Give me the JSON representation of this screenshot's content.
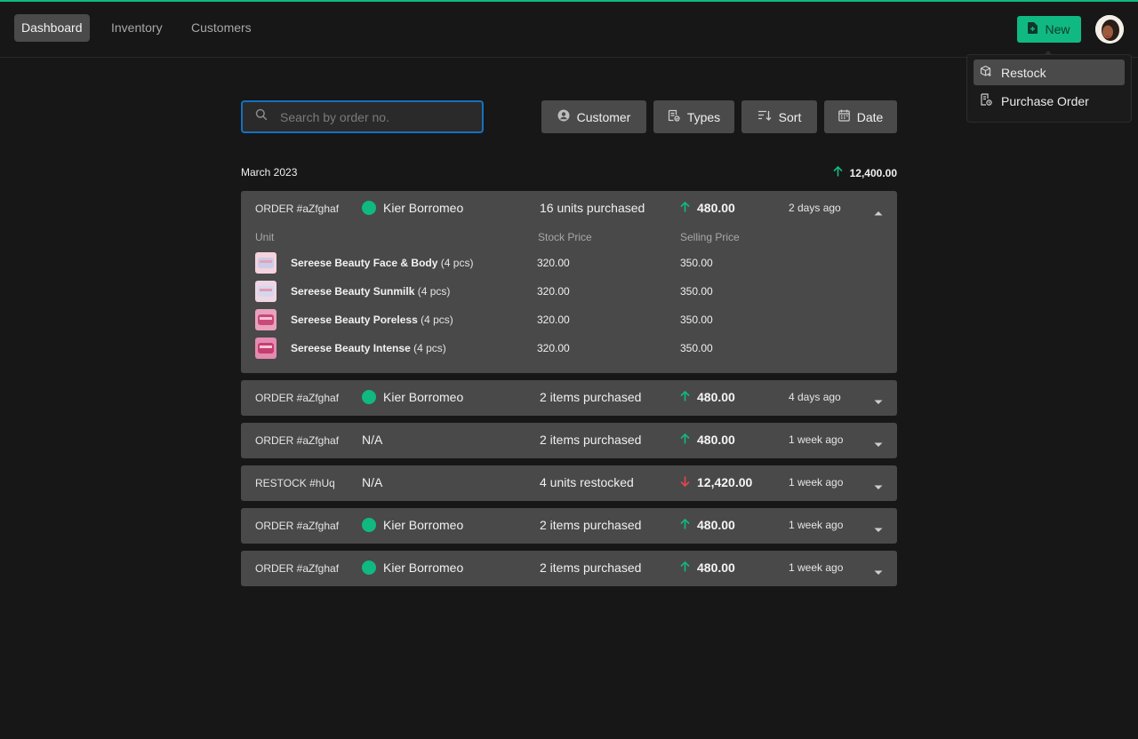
{
  "nav": {
    "items": [
      {
        "label": "Dashboard",
        "active": true
      },
      {
        "label": "Inventory",
        "active": false
      },
      {
        "label": "Customers",
        "active": false
      }
    ],
    "new_label": "New"
  },
  "dropdown": {
    "items": [
      {
        "label": "Restock",
        "icon": "box-plus-icon",
        "highlighted": true
      },
      {
        "label": "Purchase Order",
        "icon": "document-clock-icon",
        "highlighted": false
      }
    ]
  },
  "search": {
    "placeholder": "Search by order no.",
    "value": ""
  },
  "filters": [
    {
      "label": "Customer",
      "icon": "user-circle-icon"
    },
    {
      "label": "Types",
      "icon": "list-check-icon"
    },
    {
      "label": "Sort",
      "icon": "sort-icon"
    },
    {
      "label": "Date",
      "icon": "calendar-icon"
    }
  ],
  "group": {
    "month": "March 2023",
    "total": "12,400.00"
  },
  "expanded_headers": {
    "unit": "Unit",
    "stock": "Stock Price",
    "selling": "Selling Price"
  },
  "orders": [
    {
      "id": "ORDER #aZfghaf",
      "customer": "Kier Borromeo",
      "has_avatar": true,
      "summary": "16 units purchased",
      "amount": "480.00",
      "direction": "up",
      "time": "2 days ago",
      "expanded": true,
      "items": [
        {
          "name": "Sereese Beauty Face & Body",
          "qty": "(4 pcs)",
          "stock": "320.00",
          "sell": "350.00"
        },
        {
          "name": "Sereese Beauty Sunmilk",
          "qty": "(4 pcs)",
          "stock": "320.00",
          "sell": "350.00"
        },
        {
          "name": "Sereese Beauty Poreless",
          "qty": "(4 pcs)",
          "stock": "320.00",
          "sell": "350.00"
        },
        {
          "name": "Sereese Beauty Intense",
          "qty": "(4 pcs)",
          "stock": "320.00",
          "sell": "350.00"
        }
      ]
    },
    {
      "id": "ORDER #aZfghaf",
      "customer": "Kier Borromeo",
      "has_avatar": true,
      "summary": "2 items purchased",
      "amount": "480.00",
      "direction": "up",
      "time": "4 days ago",
      "expanded": false
    },
    {
      "id": "ORDER #aZfghaf",
      "customer": "N/A",
      "has_avatar": false,
      "summary": "2 items purchased",
      "amount": "480.00",
      "direction": "up",
      "time": "1 week ago",
      "expanded": false
    },
    {
      "id": "RESTOCK #hUq",
      "customer": "N/A",
      "has_avatar": false,
      "summary": "4 units restocked",
      "amount": "12,420.00",
      "direction": "down",
      "time": "1 week ago",
      "expanded": false
    },
    {
      "id": "ORDER #aZfghaf",
      "customer": "Kier Borromeo",
      "has_avatar": true,
      "summary": "2 items purchased",
      "amount": "480.00",
      "direction": "up",
      "time": "1 week ago",
      "expanded": false
    },
    {
      "id": "ORDER #aZfghaf",
      "customer": "Kier Borromeo",
      "has_avatar": true,
      "summary": "2 items purchased",
      "amount": "480.00",
      "direction": "up",
      "time": "1 week ago",
      "expanded": false
    }
  ],
  "colors": {
    "accent": "#10b981",
    "down": "#e5484d",
    "focus": "#1670bf"
  }
}
